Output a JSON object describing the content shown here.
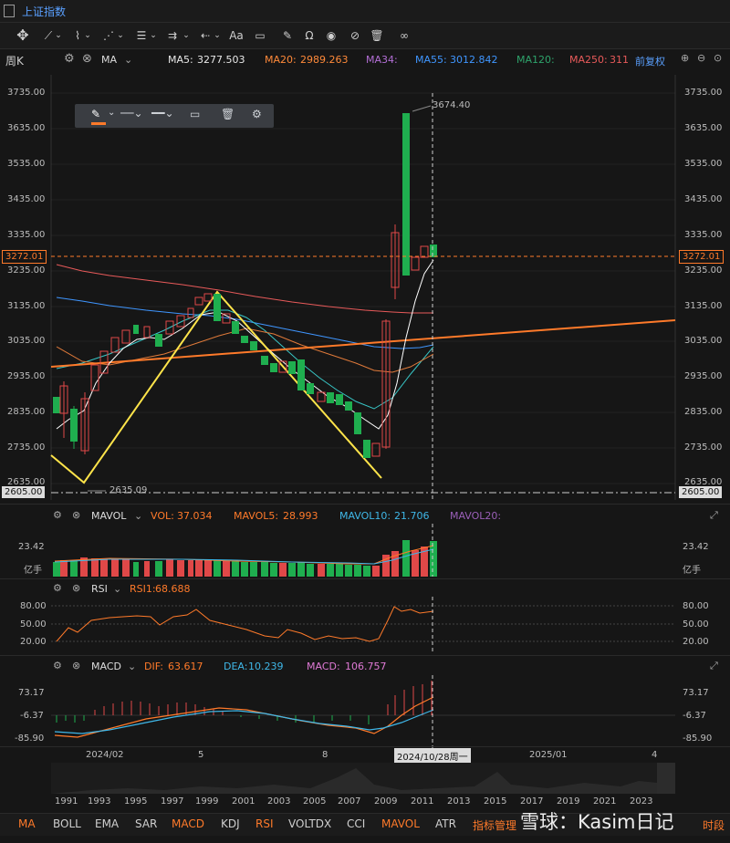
{
  "window": {
    "title": "上证指数"
  },
  "toolbar": {
    "text_tool": "Aa"
  },
  "params": {
    "period": "周K",
    "indicator": "MA",
    "ma5_label": "MA5:",
    "ma5_value": "3277.503",
    "ma20_label": "MA20:",
    "ma20_value": "2989.263",
    "ma34_label": "MA34:",
    "ma55_label": "MA55:",
    "ma55_value": "3012.842",
    "ma120_label": "MA120:",
    "ma250_label": "MA250:",
    "ma250_value": "311",
    "adjust": "前复权"
  },
  "price_axis": {
    "ticks": [
      "3735.00",
      "3635.00",
      "3535.00",
      "3435.00",
      "3335.00",
      "3235.00",
      "3135.00",
      "3035.00",
      "2935.00",
      "2835.00",
      "2735.00",
      "2635.00"
    ],
    "current": "3272.01",
    "crosshair_price": "2605.00",
    "high_label": "3674.40",
    "low_label": "2635.09"
  },
  "volume": {
    "title": "MAVOL",
    "vol_label": "VOL:",
    "vol_value": "37.034",
    "mavol5_label": "MAVOL5:",
    "mavol5_value": "28.993",
    "mavol10_label": "MAVOL10:",
    "mavol10_value": "21.706",
    "mavol20_label": "MAVOL20:",
    "tick": "23.42",
    "unit": "亿手"
  },
  "rsi": {
    "title": "RSI",
    "rsi1_label": "RSI1:",
    "rsi1_value": "68.688",
    "ticks": [
      "80.00",
      "50.00",
      "20.00"
    ]
  },
  "macd": {
    "title": "MACD",
    "dif_label": "DIF:",
    "dif_value": "63.617",
    "dea_label": "DEA:",
    "dea_value": "10.239",
    "macd_label": "MACD:",
    "macd_value": "106.757",
    "ticks": [
      "73.17",
      "-6.37",
      "-85.90"
    ]
  },
  "time_axis": {
    "labels": [
      "2024/02",
      "5",
      "8",
      "2025/01",
      "4"
    ],
    "crosshair_date": "2024/10/28周一"
  },
  "overview": {
    "years": [
      "1991",
      "1993",
      "1995",
      "1997",
      "1999",
      "2001",
      "2003",
      "2005",
      "2007",
      "2009",
      "2011",
      "2013",
      "2015",
      "2017",
      "2019",
      "2021",
      "2023"
    ]
  },
  "bottom_tabs": [
    "MA",
    "BOLL",
    "EMA",
    "SAR",
    "MACD",
    "KDJ",
    "RSI",
    "VOLTDX",
    "CCI",
    "MAVOL",
    "ATR",
    "指标管理"
  ],
  "bottom_right": "时段",
  "watermark": "雪球：Kasim日记",
  "colors": {
    "up": "#e04848",
    "down": "#1fae4f",
    "accent": "#ff7a2a",
    "link": "#5aa0ff"
  }
}
